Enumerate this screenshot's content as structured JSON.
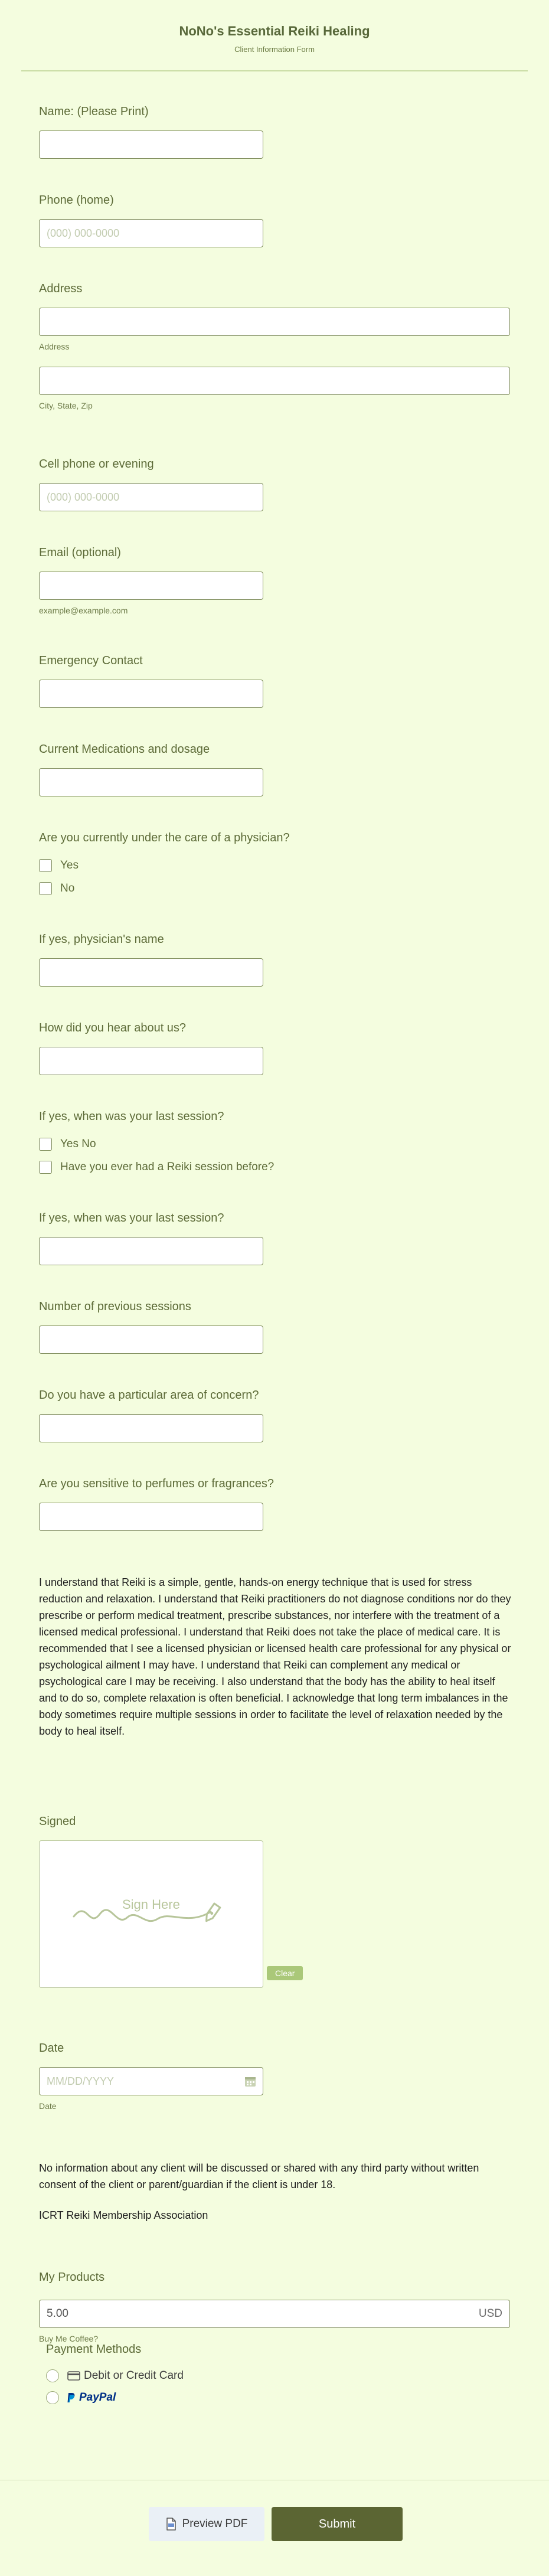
{
  "header": {
    "title": "NoNo's Essential Reiki Healing",
    "subtitle": "Client Information Form"
  },
  "fields": {
    "name": {
      "label": "Name: (Please Print)",
      "value": "",
      "placeholder": ""
    },
    "phone_home": {
      "label": "Phone (home)",
      "placeholder": "(000) 000-0000"
    },
    "address": {
      "label": "Address",
      "line1_sublabel": "Address",
      "line2_sublabel": "City, State, Zip"
    },
    "cell_phone": {
      "label": "Cell phone or evening",
      "placeholder": "(000) 000-0000"
    },
    "email": {
      "label": "Email (optional)",
      "sublabel": "example@example.com"
    },
    "emergency": {
      "label": "Emergency Contact"
    },
    "medications": {
      "label": "Current Medications and dosage"
    },
    "physician_care": {
      "label": "Are you currently under the care of a physician?",
      "options": [
        "Yes",
        "No"
      ]
    },
    "physician_name": {
      "label": "If yes, physician's name"
    },
    "hear_about": {
      "label": "How did you hear about us?"
    },
    "last_session_q": {
      "label": "If yes, when was your last session?",
      "options": [
        "Yes No",
        "Have you ever had a Reiki session before?"
      ]
    },
    "last_session": {
      "label": "If yes, when was your last session?"
    },
    "num_sessions": {
      "label": "Number of previous sessions"
    },
    "concern": {
      "label": "Do you have a particular area of concern?"
    },
    "perfumes": {
      "label": "Are you sensitive to perfumes or fragrances?"
    }
  },
  "disclaimer": "I understand that Reiki is a simple, gentle, hands-on energy technique that is used for stress reduction and relaxation. I understand that Reiki practitioners do not diagnose conditions nor do they prescribe or perform medical treatment, prescribe substances, nor interfere with the treatment of a licensed medical professional. I understand that Reiki does not take the place of medical care. It is recommended that I see a licensed physician or licensed health care professional for any physical or psychological ailment I may have. I understand that Reiki can complement any medical or psychological care I may be receiving. I also understand that the body has the ability to heal itself and to do so, complete relaxation is often beneficial. I acknowledge that long term imbalances in the body sometimes require multiple sessions in order to facilitate the level of relaxation needed by the body to heal itself.",
  "signature": {
    "label": "Signed",
    "hint": "Sign Here",
    "clear_label": "Clear"
  },
  "date": {
    "label": "Date",
    "placeholder": "MM/DD/YYYY",
    "sublabel": "Date"
  },
  "privacy_note": "No information about any client will be discussed or shared with any third party without written consent of the client or parent/guardian if the client is under 18.",
  "association": "ICRT Reiki Membership Association",
  "products": {
    "label": "My Products",
    "price": "5.00",
    "currency": "USD",
    "item": "Buy Me Coffee?"
  },
  "payment": {
    "label": "Payment Methods",
    "card_label": "Debit or Credit Card",
    "paypal_label": "PayPal"
  },
  "footer": {
    "preview_label": "Preview PDF",
    "submit_label": "Submit"
  }
}
